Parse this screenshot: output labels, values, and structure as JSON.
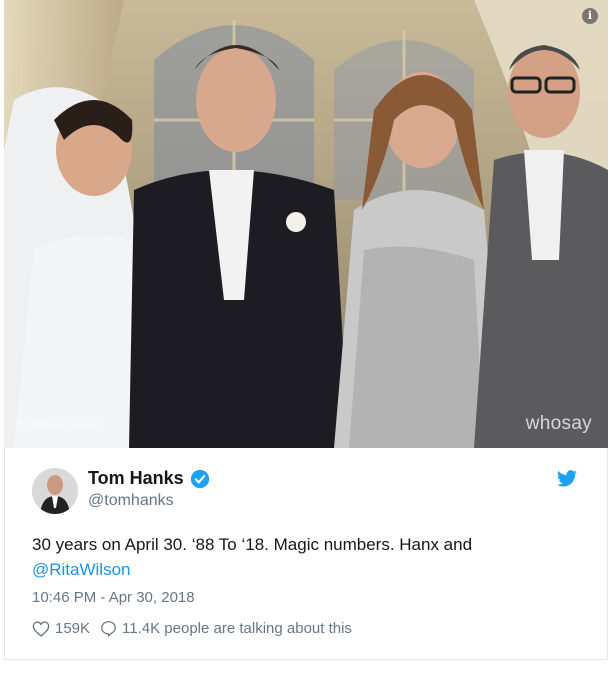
{
  "photo": {
    "info_label": "i",
    "copyright": "© 2018 Tom Hanks",
    "watermark": "whosay"
  },
  "tweet": {
    "display_name": "Tom Hanks",
    "handle": "@tomhanks",
    "text_main": "30 years on April 30. ‘88 To ‘18. Magic numbers. Hanx and",
    "mention": "@RitaWilson",
    "timestamp": "10:46 PM - Apr 30, 2018",
    "likes": "159K",
    "replies": "11.4K people are talking about this"
  },
  "icons": [
    "info-icon",
    "verified-icon",
    "twitter-bird-icon",
    "heart-icon",
    "reply-icon"
  ],
  "colors": {
    "accent": "#1da1f2",
    "link": "#1b95e0",
    "muted": "#657786",
    "text": "#14171a"
  }
}
